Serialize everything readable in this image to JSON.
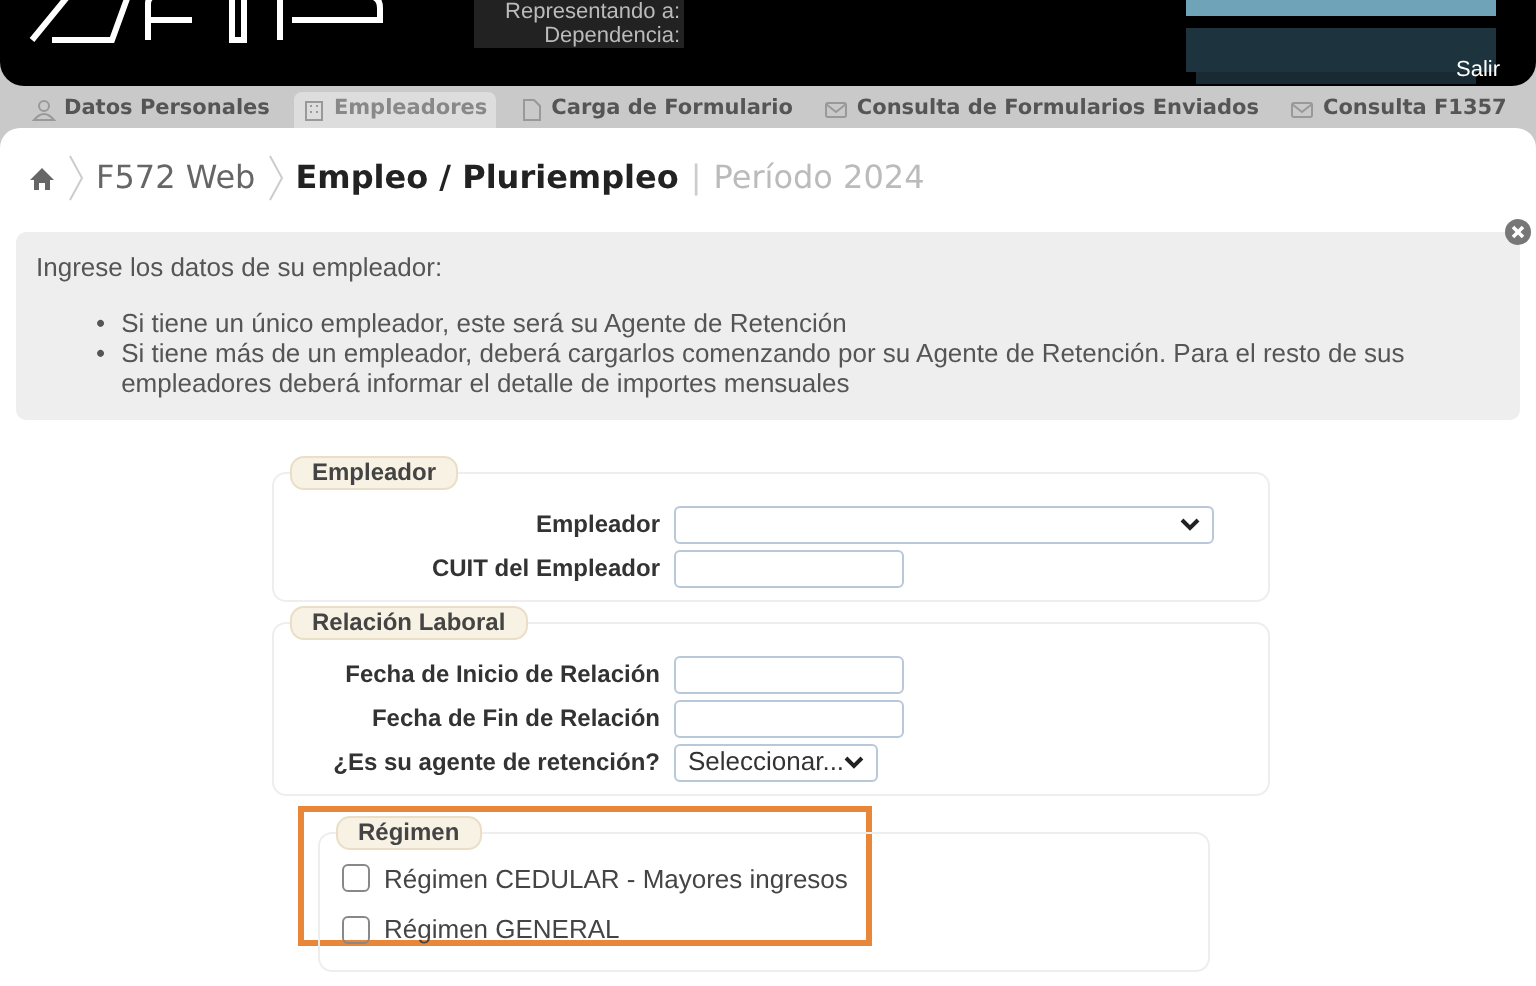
{
  "header": {
    "representing_label": "Representando a:",
    "dependency_label": "Dependencia:",
    "logout": "Salir"
  },
  "tabs": [
    {
      "label": "Datos Personales",
      "selected": false
    },
    {
      "label": "Empleadores",
      "selected": true
    },
    {
      "label": "Carga de Formulario",
      "selected": false
    },
    {
      "label": "Consulta de Formularios Enviados",
      "selected": false
    },
    {
      "label": "Consulta F1357",
      "selected": false
    }
  ],
  "breadcrumb": {
    "items": [
      "F572 Web",
      "Empleo / Pluriempleo"
    ],
    "separator": "|",
    "period": "Período 2024"
  },
  "info": {
    "intro": "Ingrese los datos de su empleador:",
    "bullets": [
      {
        "marker": "•",
        "text": "Si tiene un único empleador, este será su Agente de Retención"
      },
      {
        "marker": "•",
        "text": "Si tiene más de un empleador, deberá cargarlos comenzando por su Agente de Retención. Para el resto de sus empleadores deberá informar el detalle de importes mensuales"
      }
    ]
  },
  "sections": [
    {
      "legend": "Empleador",
      "fields": [
        {
          "label": "Empleador",
          "kind": "select"
        },
        {
          "label": "CUIT del Empleador",
          "kind": "text"
        }
      ]
    },
    {
      "legend": "Relación Laboral",
      "fields": [
        {
          "label": "Fecha de Inicio de Relación",
          "kind": "text"
        },
        {
          "label": "Fecha de Fin de Relación",
          "kind": "text"
        },
        {
          "label": "¿Es su agente de retención?",
          "kind": "select",
          "value": "Seleccionar..."
        }
      ]
    }
  ],
  "regimen": {
    "legend": "Régimen",
    "highlighted": true,
    "options": [
      {
        "label": "Régimen CEDULAR - Mayores ingresos",
        "checked": false
      },
      {
        "label": "Régimen GENERAL",
        "checked": false
      }
    ]
  }
}
